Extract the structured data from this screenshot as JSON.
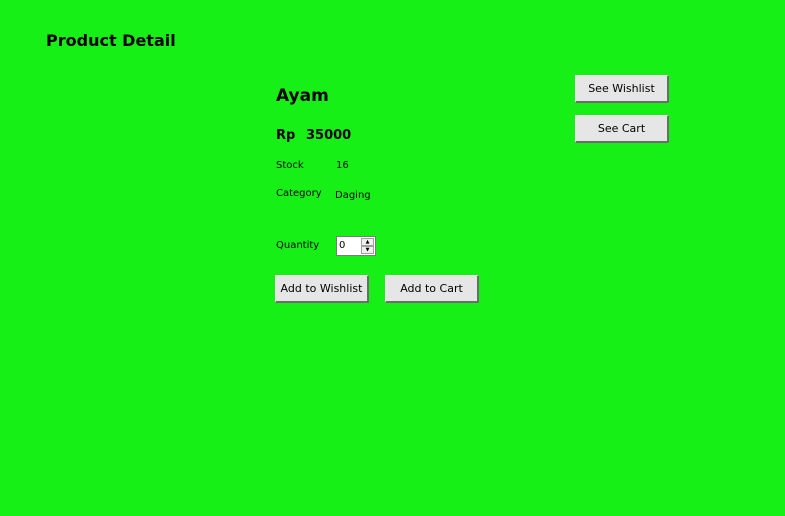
{
  "page": {
    "title": "Product Detail",
    "background_color": "#17f017"
  },
  "product": {
    "name": "Ayam",
    "currency": "Rp",
    "price": "35000",
    "stock_label": "Stock",
    "stock_value": "16",
    "category_label": "Category",
    "category_value": "Daging"
  },
  "quantity": {
    "label": "Quantity",
    "value": "0",
    "up_icon": "spinner-up-arrow",
    "down_icon": "spinner-down-arrow"
  },
  "actions": {
    "see_wishlist": "See Wishlist",
    "see_cart": "See Cart",
    "add_to_wishlist": "Add to Wishlist",
    "add_to_cart": "Add to Cart"
  }
}
